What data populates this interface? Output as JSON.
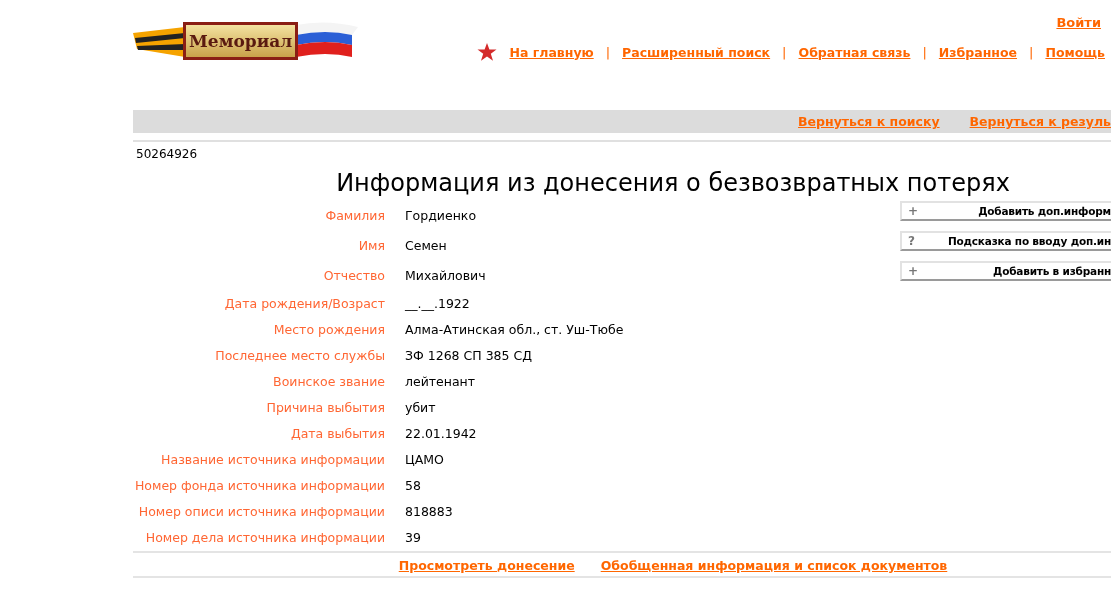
{
  "header": {
    "logo_text": "Мемориал",
    "login": "Войти",
    "nav": [
      {
        "kind": "link",
        "label": "На главную"
      },
      {
        "kind": "separator",
        "label": "|"
      },
      {
        "kind": "link",
        "label": "Расширенный поиск"
      },
      {
        "kind": "separator",
        "label": "|"
      },
      {
        "kind": "link",
        "label": "Обратная связь"
      },
      {
        "kind": "separator",
        "label": "|"
      },
      {
        "kind": "link",
        "label": "Избранное"
      },
      {
        "kind": "separator",
        "label": "|"
      },
      {
        "kind": "link",
        "label": "Помощь"
      }
    ]
  },
  "toolbar": {
    "links": [
      "Вернуться к поиску",
      "Вернуться к резуль"
    ]
  },
  "record_id": "50264926",
  "title": "Информация из донесения о безвозвратных потерях",
  "fields": [
    {
      "label": "Фамилия",
      "value": "Гордиенко"
    },
    {
      "label": "Имя",
      "value": "Семен"
    },
    {
      "label": "Отчество",
      "value": "Михайлович"
    },
    {
      "label": "Дата рождения/Возраст",
      "value": "__.__.1922"
    },
    {
      "label": "Место рождения",
      "value": "Алма-Атинская обл., ст. Уш-Тюбе"
    },
    {
      "label": "Последнее место службы",
      "value": "ЗФ 1268 СП 385 СД"
    },
    {
      "label": "Воинское звание",
      "value": "лейтенант"
    },
    {
      "label": "Причина выбытия",
      "value": "убит"
    },
    {
      "label": "Дата выбытия",
      "value": "22.01.1942"
    },
    {
      "label": "Название источника информации",
      "value": "ЦАМО"
    },
    {
      "label": "Номер фонда источника информации",
      "value": "58"
    },
    {
      "label": "Номер описи источника информации",
      "value": "818883"
    },
    {
      "label": "Номер дела источника информации",
      "value": "39"
    }
  ],
  "actions": [
    {
      "icon": "+",
      "label": "Добавить доп.информ"
    },
    {
      "icon": "?",
      "label": "Подсказка по вводу доп.ин"
    },
    {
      "icon": "+",
      "label": "Добавить в избранн"
    }
  ],
  "footer_links": [
    "Просмотреть донесение",
    "Обобщенная информация и список документов"
  ]
}
